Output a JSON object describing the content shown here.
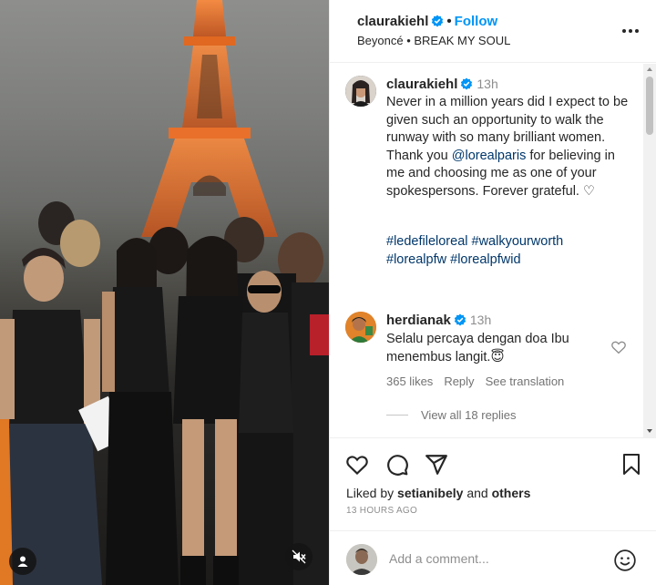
{
  "header": {
    "username": "claurakiehl",
    "separator": "•",
    "follow_label": "Follow",
    "audio": "Beyoncé • BREAK MY SOUL"
  },
  "caption": {
    "username": "claurakiehl",
    "time": "13h",
    "text_part1": "Never in a million years did I expect to be given such an opportunity to walk the runway with so many brilliant women. Thank you ",
    "mention": "@lorealparis",
    "text_part2": " for believing in me and choosing me as one of your spokespersons. Forever grateful. ",
    "heart_glyph": "♡",
    "hashtags": [
      "#ledefileloreal",
      "#walkyourworth",
      "#lorealpfw",
      "#lorealpfwid"
    ]
  },
  "comment": {
    "username": "herdianak",
    "time": "13h",
    "text": "Selalu percaya dengan doa Ibu menembus langit.",
    "emoji": "😇",
    "likes": "365 likes",
    "reply_label": "Reply",
    "translate_label": "See translation",
    "view_replies": "View all 18 replies"
  },
  "footer": {
    "liked_by_prefix": "Liked by",
    "liked_by_user": "setianibely",
    "liked_by_and": "and",
    "liked_by_others": "others",
    "time_ago": "13 HOURS AGO",
    "add_comment_placeholder": "Add a comment..."
  },
  "colors": {
    "accent": "#0095f6",
    "verified": "#0095f6",
    "link": "#00376b",
    "muted": "#737373"
  },
  "icons": [
    "verified-badge-icon",
    "more-options-icon",
    "heart-icon",
    "comment-icon",
    "share-icon",
    "bookmark-icon",
    "emoji-icon",
    "user-tag-icon",
    "mute-icon"
  ]
}
